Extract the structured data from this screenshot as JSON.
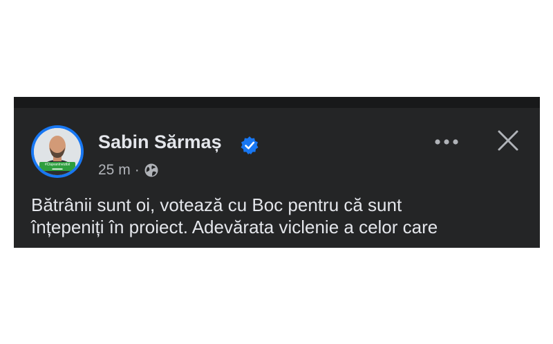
{
  "post": {
    "author_name": "Sabin Sărmaș",
    "timestamp": "25 m",
    "separator": "·",
    "privacy_icon": "globe-icon",
    "verified_icon": "verified-badge-icon",
    "avatar_badge": "#ClujeanInvizibil",
    "text_line_1": "Bătrânii sunt oi, votează cu Boc pentru că sunt",
    "text_line_2": "înțepeniți în proiect. Adevărata viclenie a celor care"
  },
  "actions": {
    "more_icon": "more-options-icon",
    "close_icon": "close-icon"
  },
  "colors": {
    "panel_background": "#242526",
    "top_strip": "#18191a",
    "primary_text": "#e4e6eb",
    "secondary_text": "#b0b3b8",
    "accent_blue": "#1877f2"
  }
}
